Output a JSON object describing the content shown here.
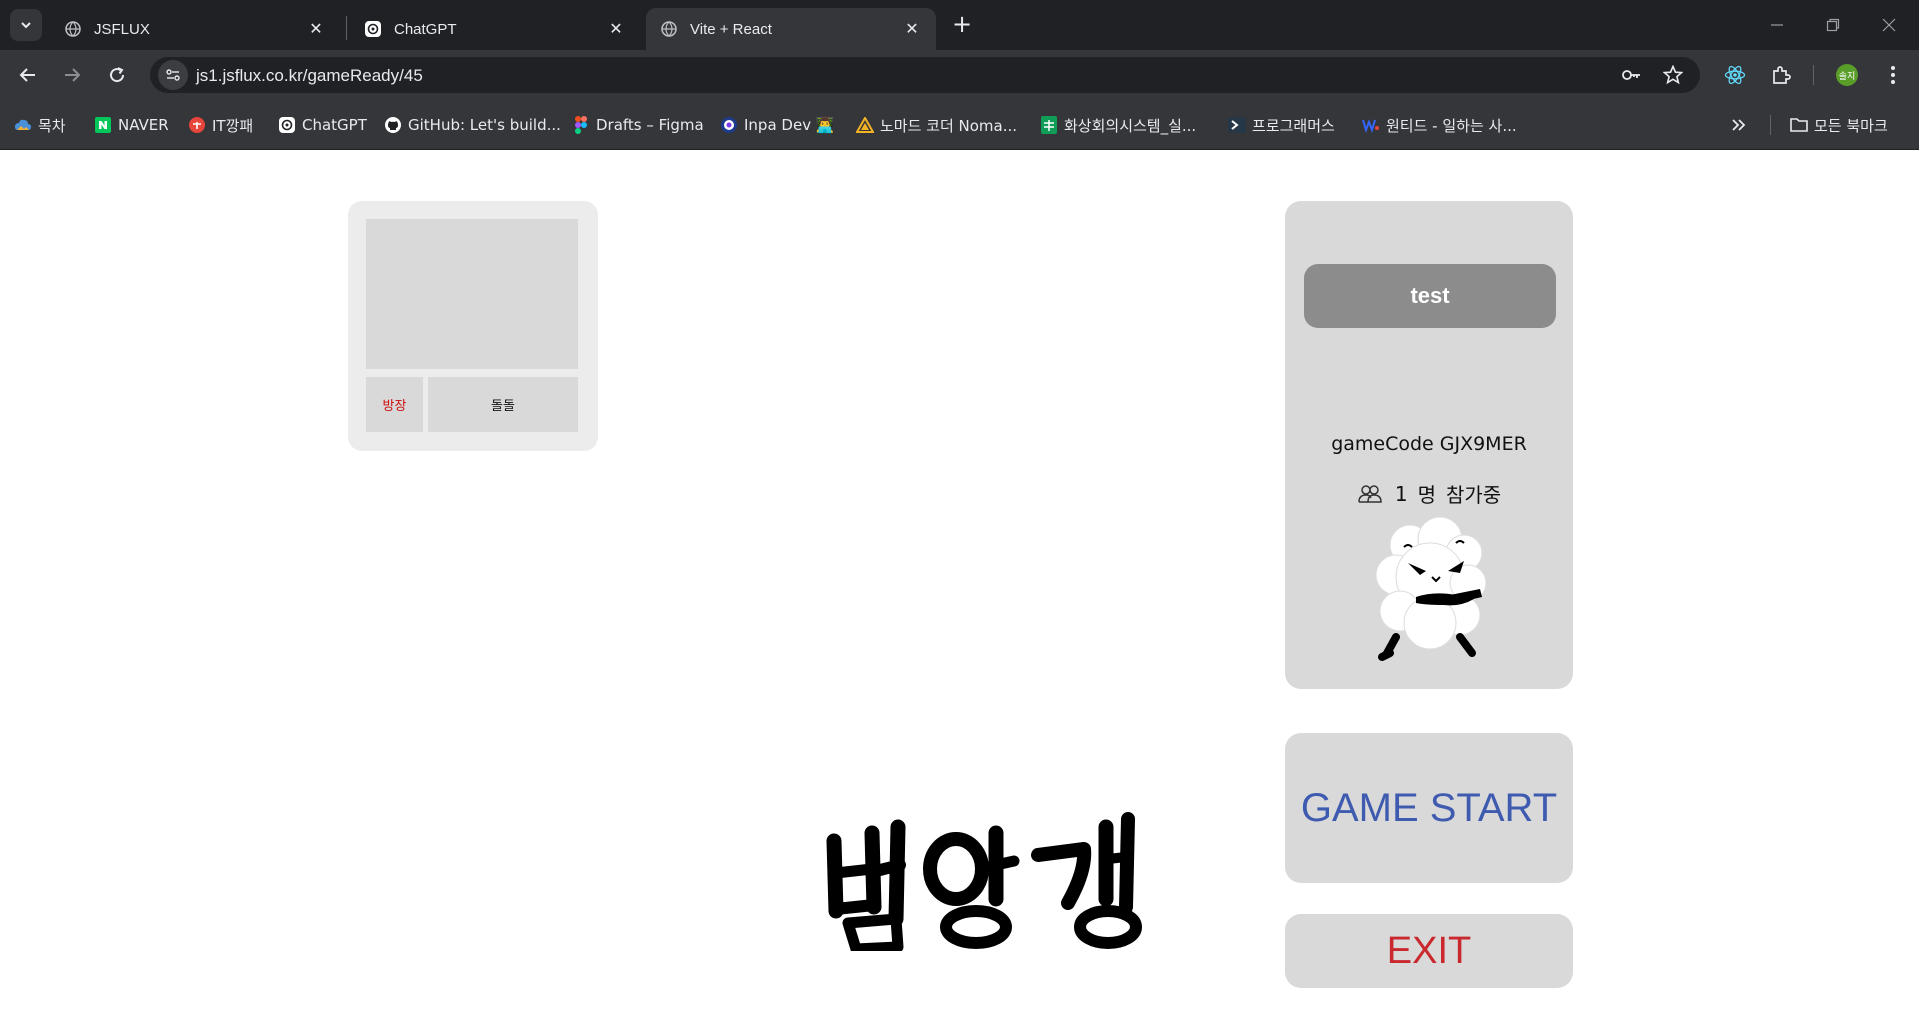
{
  "browser": {
    "tabs": [
      {
        "title": "JSFLUX",
        "icon": "globe-icon",
        "active": false
      },
      {
        "title": "ChatGPT",
        "icon": "chatgpt-icon",
        "active": false
      },
      {
        "title": "Vite + React",
        "icon": "globe-icon",
        "active": true
      }
    ],
    "url": "js1.jsflux.co.kr/gameReady/45",
    "profile_label": "솔지",
    "bookmarks": [
      {
        "label": "목차",
        "icon": "folder-cloud-icon"
      },
      {
        "label": "NAVER",
        "icon": "naver-icon"
      },
      {
        "label": "IT깡패",
        "icon": "itggangpae-icon"
      },
      {
        "label": "ChatGPT",
        "icon": "chatgpt-icon"
      },
      {
        "label": "GitHub: Let's build...",
        "icon": "github-icon"
      },
      {
        "label": "Drafts – Figma",
        "icon": "figma-icon"
      },
      {
        "label": "Inpa Dev 👨‍💻",
        "icon": "inpa-icon"
      },
      {
        "label": "노마드 코더 Noma...",
        "icon": "nomad-icon"
      },
      {
        "label": "화상회의시스템_실...",
        "icon": "sheets-icon"
      },
      {
        "label": "프로그래머스",
        "icon": "programmers-icon"
      },
      {
        "label": "원티드 - 일하는 사...",
        "icon": "wanted-icon"
      }
    ],
    "all_bookmarks_label": "모든 북마크"
  },
  "lobby": {
    "player": {
      "role": "방장",
      "name": "돌돌"
    },
    "room": {
      "title": "test",
      "game_code_label": "gameCode",
      "game_code": "GJX9MER",
      "participant_count": "1",
      "participant_unit": "명",
      "participant_text": "참가중"
    },
    "logo_text": "밤양갱",
    "start_label": "GAME START",
    "exit_label": "EXIT"
  },
  "colors": {
    "start_text": "#3f5bb0",
    "exit_text": "#c8282e",
    "host_role_text": "#cc1010",
    "card_bg": "#d9d9d9",
    "room_title_bg": "#8c8c8c"
  }
}
